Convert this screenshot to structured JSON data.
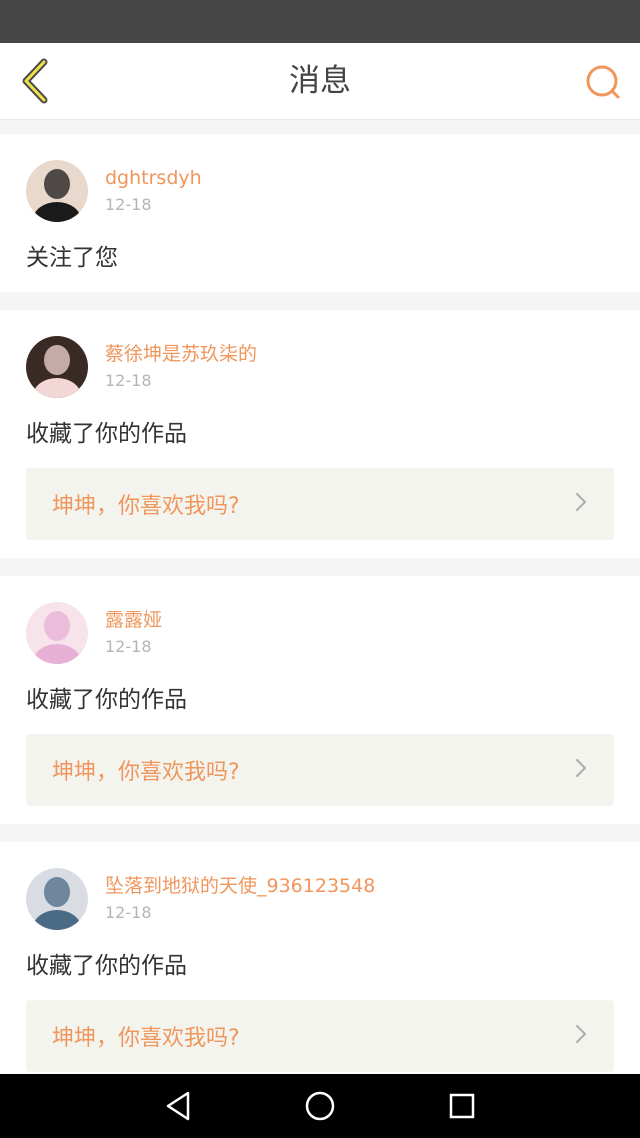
{
  "header": {
    "title": "消息",
    "back_icon": "chevron-left-icon",
    "search_icon": "search-icon",
    "accent_color": "#f0965c"
  },
  "messages": [
    {
      "username": "dghtrsdyh",
      "date": "12-18",
      "action": "关注了您",
      "work_title": null,
      "avatar_colors": [
        "#1a1a1a",
        "#e9d8cc"
      ]
    },
    {
      "username": "蔡徐坤是苏玖柒的",
      "date": "12-18",
      "action": "收藏了你的作品",
      "work_title": "坤坤，你喜欢我吗?",
      "avatar_colors": [
        "#f3d6d6",
        "#3a2a26"
      ]
    },
    {
      "username": "露露娅",
      "date": "12-18",
      "action": "收藏了你的作品",
      "work_title": "坤坤，你喜欢我吗?",
      "avatar_colors": [
        "#e7b0d6",
        "#f6e4ea"
      ]
    },
    {
      "username": "坠落到地狱的天使_936123548",
      "date": "12-18",
      "action": "收藏了你的作品",
      "work_title": "坤坤，你喜欢我吗?",
      "avatar_colors": [
        "#4a6a86",
        "#d9dde3"
      ]
    }
  ],
  "nav": {
    "back_icon": "triangle-back-icon",
    "home_icon": "circle-home-icon",
    "recents_icon": "square-recents-icon"
  }
}
